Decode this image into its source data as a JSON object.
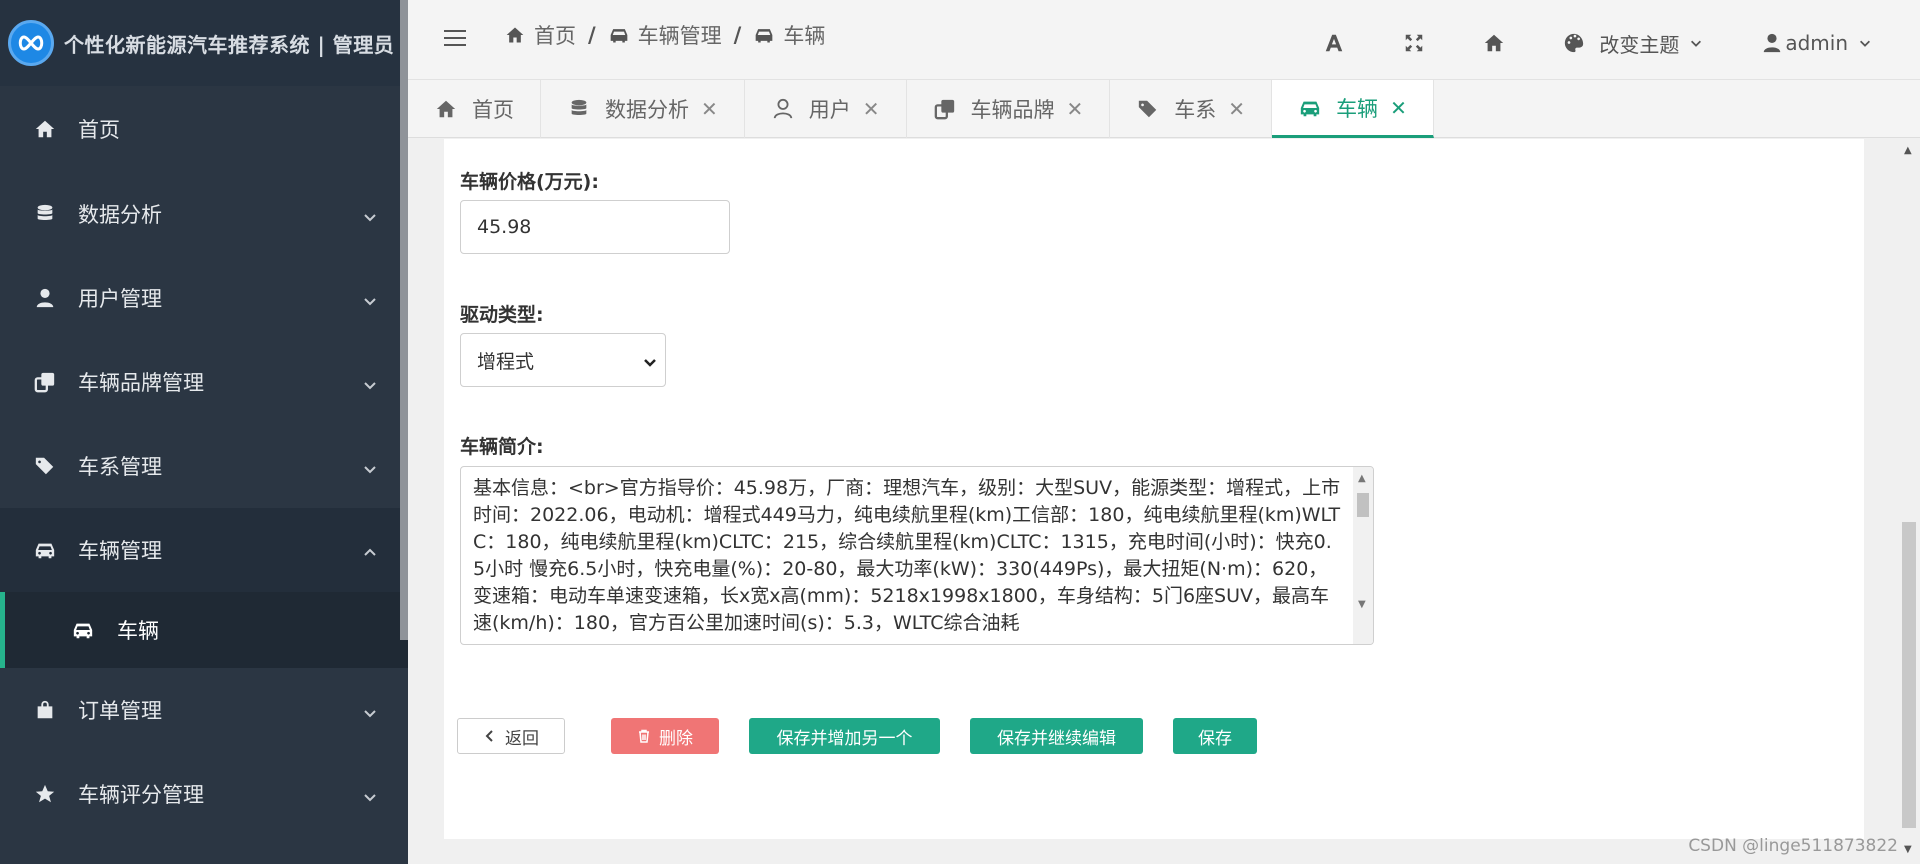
{
  "brand": {
    "title": "个性化新能源汽车推荐系统 | 管理员"
  },
  "sidebar": {
    "items": [
      {
        "label": "首页",
        "icon": "home-icon"
      },
      {
        "label": "数据分析",
        "icon": "database-icon"
      },
      {
        "label": "用户管理",
        "icon": "user-icon"
      },
      {
        "label": "车辆品牌管理",
        "icon": "copy-icon"
      },
      {
        "label": "车系管理",
        "icon": "tags-icon"
      },
      {
        "label": "车辆管理",
        "icon": "car-icon",
        "expanded": true
      },
      {
        "label": "订单管理",
        "icon": "shopping-bag-icon"
      },
      {
        "label": "车辆评分管理",
        "icon": "star-icon"
      }
    ],
    "sub_item": {
      "label": "车辆",
      "icon": "car-icon"
    }
  },
  "breadcrumb": {
    "items": [
      "首页",
      "车辆管理",
      "车辆"
    ]
  },
  "header": {
    "theme_label": "改变主题",
    "user_label": "admin"
  },
  "tabs": [
    {
      "label": "首页",
      "icon": "home-icon",
      "closable": false
    },
    {
      "label": "数据分析",
      "icon": "database-icon",
      "closable": true
    },
    {
      "label": "用户",
      "icon": "user-icon",
      "closable": true
    },
    {
      "label": "车辆品牌",
      "icon": "copy-icon",
      "closable": true
    },
    {
      "label": "车系",
      "icon": "tags-icon",
      "closable": true
    },
    {
      "label": "车辆",
      "icon": "car-icon",
      "closable": true,
      "active": true
    }
  ],
  "form": {
    "price_label": "车辆价格(万元):",
    "price_value": "45.98",
    "drive_label": "驱动类型:",
    "drive_value": "增程式",
    "intro_label": "车辆简介:",
    "intro_value": "基本信息：<br>官方指导价：45.98万，厂商：理想汽车，级别：大型SUV，能源类型：增程式，上市时间：2022.06，电动机：增程式449马力，纯电续航里程(km)工信部：180，纯电续航里程(km)WLTC：180，纯电续航里程(km)CLTC：215，综合续航里程(km)CLTC：1315，充电时间(小时)：快充0.5小时 慢充6.5小时，快充电量(%)：20-80，最大功率(kW)：330(449Ps)，最大扭矩(N·m)：620，变速箱：电动车单速变速箱，长x宽x高(mm)：5218x1998x1800，车身结构：5门6座SUV，最高车速(km/h)：180，官方百公里加速时间(s)：5.3，WLTC综合油耗"
  },
  "buttons": {
    "back": "返回",
    "delete": "删除",
    "save_add": "保存并增加另一个",
    "save_continue": "保存并继续编辑",
    "save": "保存"
  },
  "watermark": "CSDN @linge511873822",
  "colors": {
    "accent": "#1a9e7a",
    "sidebar_bg": "#2b3643",
    "danger": "#f07575",
    "primary_button": "#1fa888"
  }
}
